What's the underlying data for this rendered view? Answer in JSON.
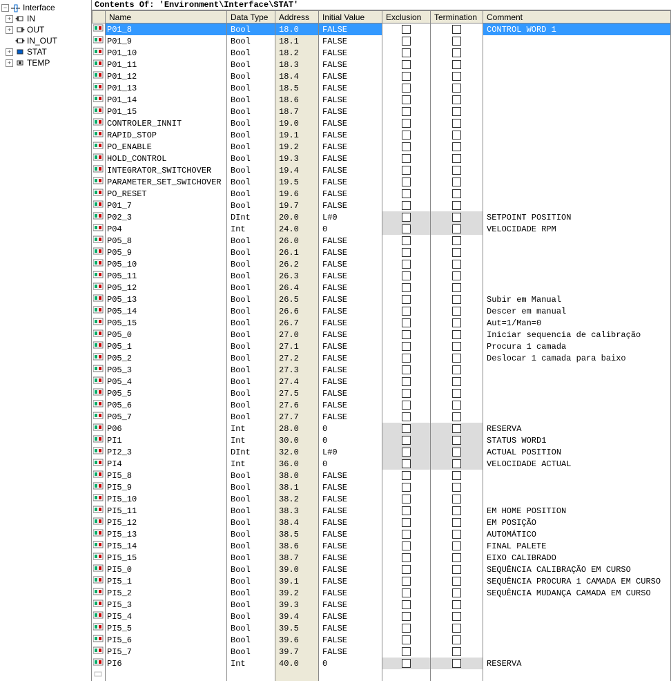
{
  "tree": {
    "root": "Interface",
    "items": [
      "IN",
      "OUT",
      "IN_OUT",
      "STAT",
      "TEMP"
    ]
  },
  "pathbar": "Contents Of: 'Environment\\Interface\\STAT'",
  "columns": [
    "Name",
    "Data Type",
    "Address",
    "Initial Value",
    "Exclusion",
    "Termination",
    "Comment"
  ],
  "rows": [
    {
      "n": "P01_8",
      "t": "Bool",
      "a": "18.0",
      "v": "FALSE",
      "g": false,
      "c": "CONTROL WORD 1",
      "sel": true
    },
    {
      "n": "P01_9",
      "t": "Bool",
      "a": "18.1",
      "v": "FALSE",
      "g": false,
      "c": ""
    },
    {
      "n": "P01_10",
      "t": "Bool",
      "a": "18.2",
      "v": "FALSE",
      "g": false,
      "c": ""
    },
    {
      "n": "P01_11",
      "t": "Bool",
      "a": "18.3",
      "v": "FALSE",
      "g": false,
      "c": ""
    },
    {
      "n": "P01_12",
      "t": "Bool",
      "a": "18.4",
      "v": "FALSE",
      "g": false,
      "c": ""
    },
    {
      "n": "P01_13",
      "t": "Bool",
      "a": "18.5",
      "v": "FALSE",
      "g": false,
      "c": ""
    },
    {
      "n": "P01_14",
      "t": "Bool",
      "a": "18.6",
      "v": "FALSE",
      "g": false,
      "c": ""
    },
    {
      "n": "P01_15",
      "t": "Bool",
      "a": "18.7",
      "v": "FALSE",
      "g": false,
      "c": ""
    },
    {
      "n": "CONTROLER_INNIT",
      "t": "Bool",
      "a": "19.0",
      "v": "FALSE",
      "g": false,
      "c": ""
    },
    {
      "n": "RAPID_STOP",
      "t": "Bool",
      "a": "19.1",
      "v": "FALSE",
      "g": false,
      "c": ""
    },
    {
      "n": "PO_ENABLE",
      "t": "Bool",
      "a": "19.2",
      "v": "FALSE",
      "g": false,
      "c": ""
    },
    {
      "n": "HOLD_CONTROL",
      "t": "Bool",
      "a": "19.3",
      "v": "FALSE",
      "g": false,
      "c": ""
    },
    {
      "n": "INTEGRATOR_SWITCHOVER",
      "t": "Bool",
      "a": "19.4",
      "v": "FALSE",
      "g": false,
      "c": ""
    },
    {
      "n": "PARAMETER_SET_SWICHOVER",
      "t": "Bool",
      "a": "19.5",
      "v": "FALSE",
      "g": false,
      "c": ""
    },
    {
      "n": "PO_RESET",
      "t": "Bool",
      "a": "19.6",
      "v": "FALSE",
      "g": false,
      "c": ""
    },
    {
      "n": "P01_7",
      "t": "Bool",
      "a": "19.7",
      "v": "FALSE",
      "g": false,
      "c": ""
    },
    {
      "n": "P02_3",
      "t": "DInt",
      "a": "20.0",
      "v": "L#0",
      "g": true,
      "c": "SETPOINT POSITION"
    },
    {
      "n": "P04",
      "t": "Int",
      "a": "24.0",
      "v": "0",
      "g": true,
      "c": "VELOCIDADE RPM"
    },
    {
      "n": "P05_8",
      "t": "Bool",
      "a": "26.0",
      "v": "FALSE",
      "g": false,
      "c": ""
    },
    {
      "n": "P05_9",
      "t": "Bool",
      "a": "26.1",
      "v": "FALSE",
      "g": false,
      "c": ""
    },
    {
      "n": "P05_10",
      "t": "Bool",
      "a": "26.2",
      "v": "FALSE",
      "g": false,
      "c": ""
    },
    {
      "n": "P05_11",
      "t": "Bool",
      "a": "26.3",
      "v": "FALSE",
      "g": false,
      "c": ""
    },
    {
      "n": "P05_12",
      "t": "Bool",
      "a": "26.4",
      "v": "FALSE",
      "g": false,
      "c": ""
    },
    {
      "n": "P05_13",
      "t": "Bool",
      "a": "26.5",
      "v": "FALSE",
      "g": false,
      "c": "Subir em Manual"
    },
    {
      "n": "P05_14",
      "t": "Bool",
      "a": "26.6",
      "v": "FALSE",
      "g": false,
      "c": "Descer em manual"
    },
    {
      "n": "P05_15",
      "t": "Bool",
      "a": "26.7",
      "v": "FALSE",
      "g": false,
      "c": "Aut=1/Man=0"
    },
    {
      "n": "P05_0",
      "t": "Bool",
      "a": "27.0",
      "v": "FALSE",
      "g": false,
      "c": "Iniciar sequencia de calibração"
    },
    {
      "n": "P05_1",
      "t": "Bool",
      "a": "27.1",
      "v": "FALSE",
      "g": false,
      "c": "Procura 1 camada"
    },
    {
      "n": "P05_2",
      "t": "Bool",
      "a": "27.2",
      "v": "FALSE",
      "g": false,
      "c": "Deslocar 1 camada para baixo"
    },
    {
      "n": "P05_3",
      "t": "Bool",
      "a": "27.3",
      "v": "FALSE",
      "g": false,
      "c": ""
    },
    {
      "n": "P05_4",
      "t": "Bool",
      "a": "27.4",
      "v": "FALSE",
      "g": false,
      "c": ""
    },
    {
      "n": "P05_5",
      "t": "Bool",
      "a": "27.5",
      "v": "FALSE",
      "g": false,
      "c": ""
    },
    {
      "n": "P05_6",
      "t": "Bool",
      "a": "27.6",
      "v": "FALSE",
      "g": false,
      "c": ""
    },
    {
      "n": "P05_7",
      "t": "Bool",
      "a": "27.7",
      "v": "FALSE",
      "g": false,
      "c": ""
    },
    {
      "n": "P06",
      "t": "Int",
      "a": "28.0",
      "v": "0",
      "g": true,
      "c": "RESERVA"
    },
    {
      "n": "PI1",
      "t": "Int",
      "a": "30.0",
      "v": "0",
      "g": true,
      "c": "STATUS WORD1"
    },
    {
      "n": "PI2_3",
      "t": "DInt",
      "a": "32.0",
      "v": "L#0",
      "g": true,
      "c": "ACTUAL POSITION"
    },
    {
      "n": "PI4",
      "t": "Int",
      "a": "36.0",
      "v": "0",
      "g": true,
      "c": "VELOCIDADE ACTUAL"
    },
    {
      "n": "PI5_8",
      "t": "Bool",
      "a": "38.0",
      "v": "FALSE",
      "g": false,
      "c": ""
    },
    {
      "n": "PI5_9",
      "t": "Bool",
      "a": "38.1",
      "v": "FALSE",
      "g": false,
      "c": ""
    },
    {
      "n": "PI5_10",
      "t": "Bool",
      "a": "38.2",
      "v": "FALSE",
      "g": false,
      "c": ""
    },
    {
      "n": "PI5_11",
      "t": "Bool",
      "a": "38.3",
      "v": "FALSE",
      "g": false,
      "c": "EM HOME POSITION"
    },
    {
      "n": "PI5_12",
      "t": "Bool",
      "a": "38.4",
      "v": "FALSE",
      "g": false,
      "c": "EM POSIÇÃO"
    },
    {
      "n": "PI5_13",
      "t": "Bool",
      "a": "38.5",
      "v": "FALSE",
      "g": false,
      "c": "AUTOMÁTICO"
    },
    {
      "n": "PI5_14",
      "t": "Bool",
      "a": "38.6",
      "v": "FALSE",
      "g": false,
      "c": "FINAL PALETE"
    },
    {
      "n": "PI5_15",
      "t": "Bool",
      "a": "38.7",
      "v": "FALSE",
      "g": false,
      "c": "EIXO CALIBRADO"
    },
    {
      "n": "PI5_0",
      "t": "Bool",
      "a": "39.0",
      "v": "FALSE",
      "g": false,
      "c": "SEQUÊNCIA CALIBRAÇÃO EM CURSO"
    },
    {
      "n": "PI5_1",
      "t": "Bool",
      "a": "39.1",
      "v": "FALSE",
      "g": false,
      "c": "SEQUÊNCIA PROCURA 1 CAMADA EM CURSO"
    },
    {
      "n": "PI5_2",
      "t": "Bool",
      "a": "39.2",
      "v": "FALSE",
      "g": false,
      "c": "SEQUÊNCIA MUDANÇA CAMADA EM CURSO"
    },
    {
      "n": "PI5_3",
      "t": "Bool",
      "a": "39.3",
      "v": "FALSE",
      "g": false,
      "c": ""
    },
    {
      "n": "PI5_4",
      "t": "Bool",
      "a": "39.4",
      "v": "FALSE",
      "g": false,
      "c": ""
    },
    {
      "n": "PI5_5",
      "t": "Bool",
      "a": "39.5",
      "v": "FALSE",
      "g": false,
      "c": ""
    },
    {
      "n": "PI5_6",
      "t": "Bool",
      "a": "39.6",
      "v": "FALSE",
      "g": false,
      "c": ""
    },
    {
      "n": "PI5_7",
      "t": "Bool",
      "a": "39.7",
      "v": "FALSE",
      "g": false,
      "c": ""
    },
    {
      "n": "PI6",
      "t": "Int",
      "a": "40.0",
      "v": "0",
      "g": true,
      "c": "RESERVA"
    },
    {
      "n": "",
      "t": "",
      "a": "",
      "v": "",
      "g": false,
      "c": "",
      "empty": true
    }
  ]
}
